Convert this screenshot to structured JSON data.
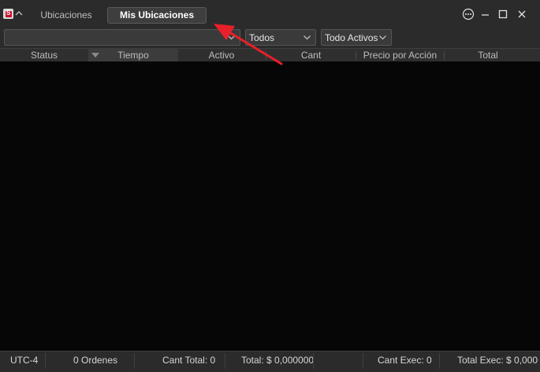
{
  "window": {
    "app_icon_letter": "S",
    "tabs": [
      {
        "label": "Ubicaciones",
        "active": false
      },
      {
        "label": "Mis Ubicaciones",
        "active": true
      }
    ],
    "controls": [
      "more-icon",
      "minimize-icon",
      "maximize-icon",
      "close-icon"
    ]
  },
  "filters": {
    "search_value": "",
    "status_selected": "Todos",
    "assets_selected": "Todo Activos"
  },
  "grid": {
    "columns": [
      "Status",
      "Tiempo",
      "Activo",
      "Cant",
      "Precio por Acción",
      "Total"
    ],
    "sorted_column": "Tiempo",
    "rows": []
  },
  "statusbar": {
    "timezone": "UTC-4",
    "orders": "0 Ordenes",
    "cant_total": "Cant Total: 0",
    "total": "Total: $ 0,000000",
    "cant_exec": "Cant Exec: 0",
    "total_exec": "Total Exec: $ 0,000"
  },
  "colors": {
    "annotation_arrow": "#e8202a",
    "background": "#2b2b2b",
    "grid_body": "#060606"
  }
}
